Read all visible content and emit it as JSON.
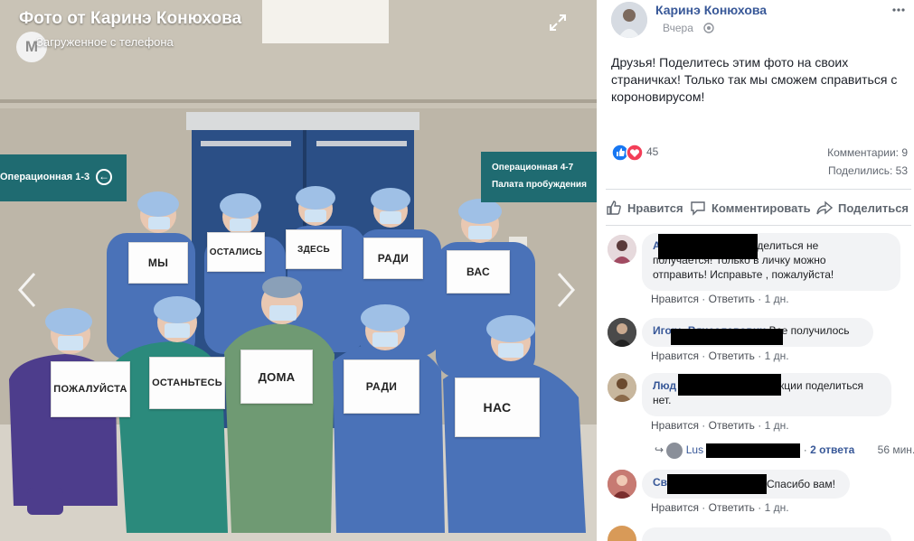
{
  "viewer": {
    "title": "Фото от Каринэ Конюхова",
    "subtitle": "Загруженное с телефона",
    "logo_letter": "М",
    "wall_signs": {
      "left": "Операционная 1-3",
      "right_line1": "Операционная 4-7",
      "right_line2": "Палата пробуждения"
    },
    "signs": {
      "s1": "МЫ",
      "s2": "ОСТАЛИСЬ",
      "s3": "ЗДЕСЬ",
      "s4": "РАДИ",
      "s5": "ВАС",
      "s6": "ПОЖАЛУЙСТА",
      "s7": "ОСТАНЬТЕСЬ",
      "s8": "ДОМА",
      "s9": "РАДИ",
      "s10": "НАС"
    }
  },
  "post": {
    "author": "Каринэ Конюхова",
    "time": "Вчера",
    "text": "Друзья! Поделитесь этим фото на своих страничках! Только так мы сможем справиться с короновирусом!",
    "reaction_count": "45",
    "comments_count": "Комментарии: 9",
    "shares_count": "Поделились: 53",
    "actions": {
      "like": "Нравится",
      "comment": "Комментировать",
      "share": "Поделиться"
    }
  },
  "comments": [
    {
      "name": "Ал",
      "text_line1": "оделиться не",
      "text_line2": "получается! Только в личку можно",
      "text_line3": "отправить! Исправьте , пожалуйста!",
      "like": "Нравится",
      "reply": "Ответить",
      "age": "1 дн."
    },
    {
      "name": "Игорь Вячеславович",
      "text": "Все получилось",
      "like": "Нравится",
      "reply": "Ответить",
      "age": "1 дн."
    },
    {
      "name": "Люд",
      "text_line1": "кции поделиться",
      "text_line2": "нет.",
      "like": "Нравится",
      "reply": "Ответить",
      "age": "1 дн.",
      "reply_preview": {
        "name": "Lus",
        "count": "2 ответа",
        "age": "56 мин."
      }
    },
    {
      "name": "Све",
      "text": "Спасибо вам!",
      "like": "Нравится",
      "reply": "Ответить",
      "age": "1 дн."
    }
  ],
  "colors": {
    "link": "#385898",
    "like_blue": "#1877f2",
    "love_red": "#f33e58",
    "wall_sign": "#1f6b71"
  }
}
